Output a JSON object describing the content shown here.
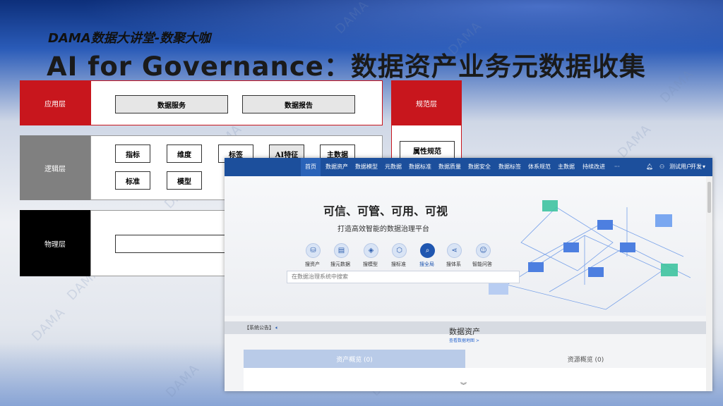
{
  "slide": {
    "subtitle": "DAMA数据大讲堂-数聚大咖",
    "title": "AI for Governance：数据资产业务元数据收集",
    "watermark": "DAMA"
  },
  "colors": {
    "red": "#c8161d",
    "gray": "#808080",
    "black": "#000000",
    "nav": "#1c4f9c"
  },
  "diagram": {
    "app_layer": {
      "label": "应用层",
      "boxes": [
        "数据服务",
        "数据报告"
      ]
    },
    "logic_layer": {
      "label": "逻辑层",
      "row1": [
        "指标",
        "维度",
        "标签",
        "AI特征",
        "主数据"
      ],
      "row2": [
        "标准",
        "模型"
      ]
    },
    "physical_layer": {
      "label": "物理层"
    },
    "norm_layer": {
      "label": "规范层",
      "boxes": [
        "属性规范"
      ]
    }
  },
  "app": {
    "nav": [
      "首页",
      "数据资产",
      "数据模型",
      "元数据",
      "数据标准",
      "数据质量",
      "数据安全",
      "数据标签",
      "体系规范",
      "主数据",
      "持续改进",
      "···"
    ],
    "user": "测试用户",
    "env": "开发",
    "hero_title": "可信、可管、可用、可视",
    "hero_sub": "打造高效智能的数据治理平台",
    "quick": [
      {
        "label": "搜资产",
        "icon": "database-icon",
        "glyph": "⛁"
      },
      {
        "label": "搜元数据",
        "icon": "chart-icon",
        "glyph": "▤"
      },
      {
        "label": "搜模型",
        "icon": "model-icon",
        "glyph": "◈"
      },
      {
        "label": "搜标准",
        "icon": "cube-icon",
        "glyph": "⬡"
      },
      {
        "label": "搜全局",
        "icon": "search-icon",
        "glyph": "⌕"
      },
      {
        "label": "搜体系",
        "icon": "share-icon",
        "glyph": "⋖"
      },
      {
        "label": "智能问答",
        "icon": "robot-icon",
        "glyph": "☺"
      }
    ],
    "search_placeholder": "在数据治理系统中搜索",
    "announcement": "【系统公告】",
    "assets_title": "数据资产",
    "assets_sub": "查看数据地图 >",
    "tab_assets": "资产概览 (0)",
    "tab_resources": "资源概览 (0)"
  }
}
